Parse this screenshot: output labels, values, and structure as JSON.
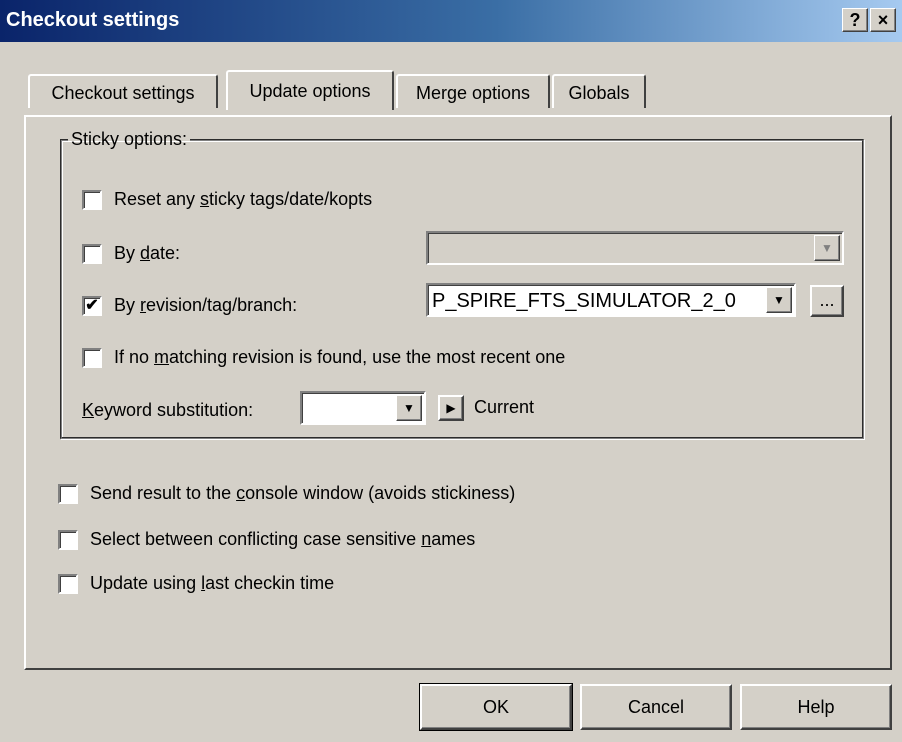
{
  "window": {
    "title": "Checkout settings",
    "help_label": "?",
    "close_label": "×"
  },
  "tabs": [
    {
      "label": "Checkout settings",
      "active": false
    },
    {
      "label": "Update options",
      "active": true
    },
    {
      "label": "Merge options",
      "active": false
    },
    {
      "label": "Globals",
      "active": false
    }
  ],
  "sticky": {
    "legend": "Sticky options:",
    "reset": {
      "pre": "Reset any ",
      "key": "s",
      "post": "ticky tags/date/kopts",
      "checked": false
    },
    "by_date": {
      "pre": "By ",
      "key": "d",
      "post": "ate:",
      "checked": false,
      "value": ""
    },
    "by_revision": {
      "pre": "By ",
      "key": "r",
      "post": "evision/tag/branch:",
      "checked": true,
      "value": "P_SPIRE_FTS_SIMULATOR_2_0",
      "browse_label": "..."
    },
    "no_match": {
      "pre": "If no ",
      "key": "m",
      "post": "atching revision is found, use the most recent one",
      "checked": false
    },
    "keyword": {
      "key": "K",
      "post": "eyword substitution:",
      "value": "",
      "current_label": "Current"
    }
  },
  "options": {
    "console": {
      "pre": "Send result to the ",
      "key": "c",
      "post": "onsole window (avoids stickiness)",
      "checked": false
    },
    "case_names": {
      "pre": "Select between conflicting case sensitive ",
      "key": "n",
      "post": "ames",
      "checked": false
    },
    "last_checkin": {
      "pre": "Update using ",
      "key": "l",
      "post": "ast checkin time",
      "checked": false
    }
  },
  "buttons": {
    "ok": "OK",
    "cancel": "Cancel",
    "help": "Help"
  },
  "checkmark": "✔"
}
